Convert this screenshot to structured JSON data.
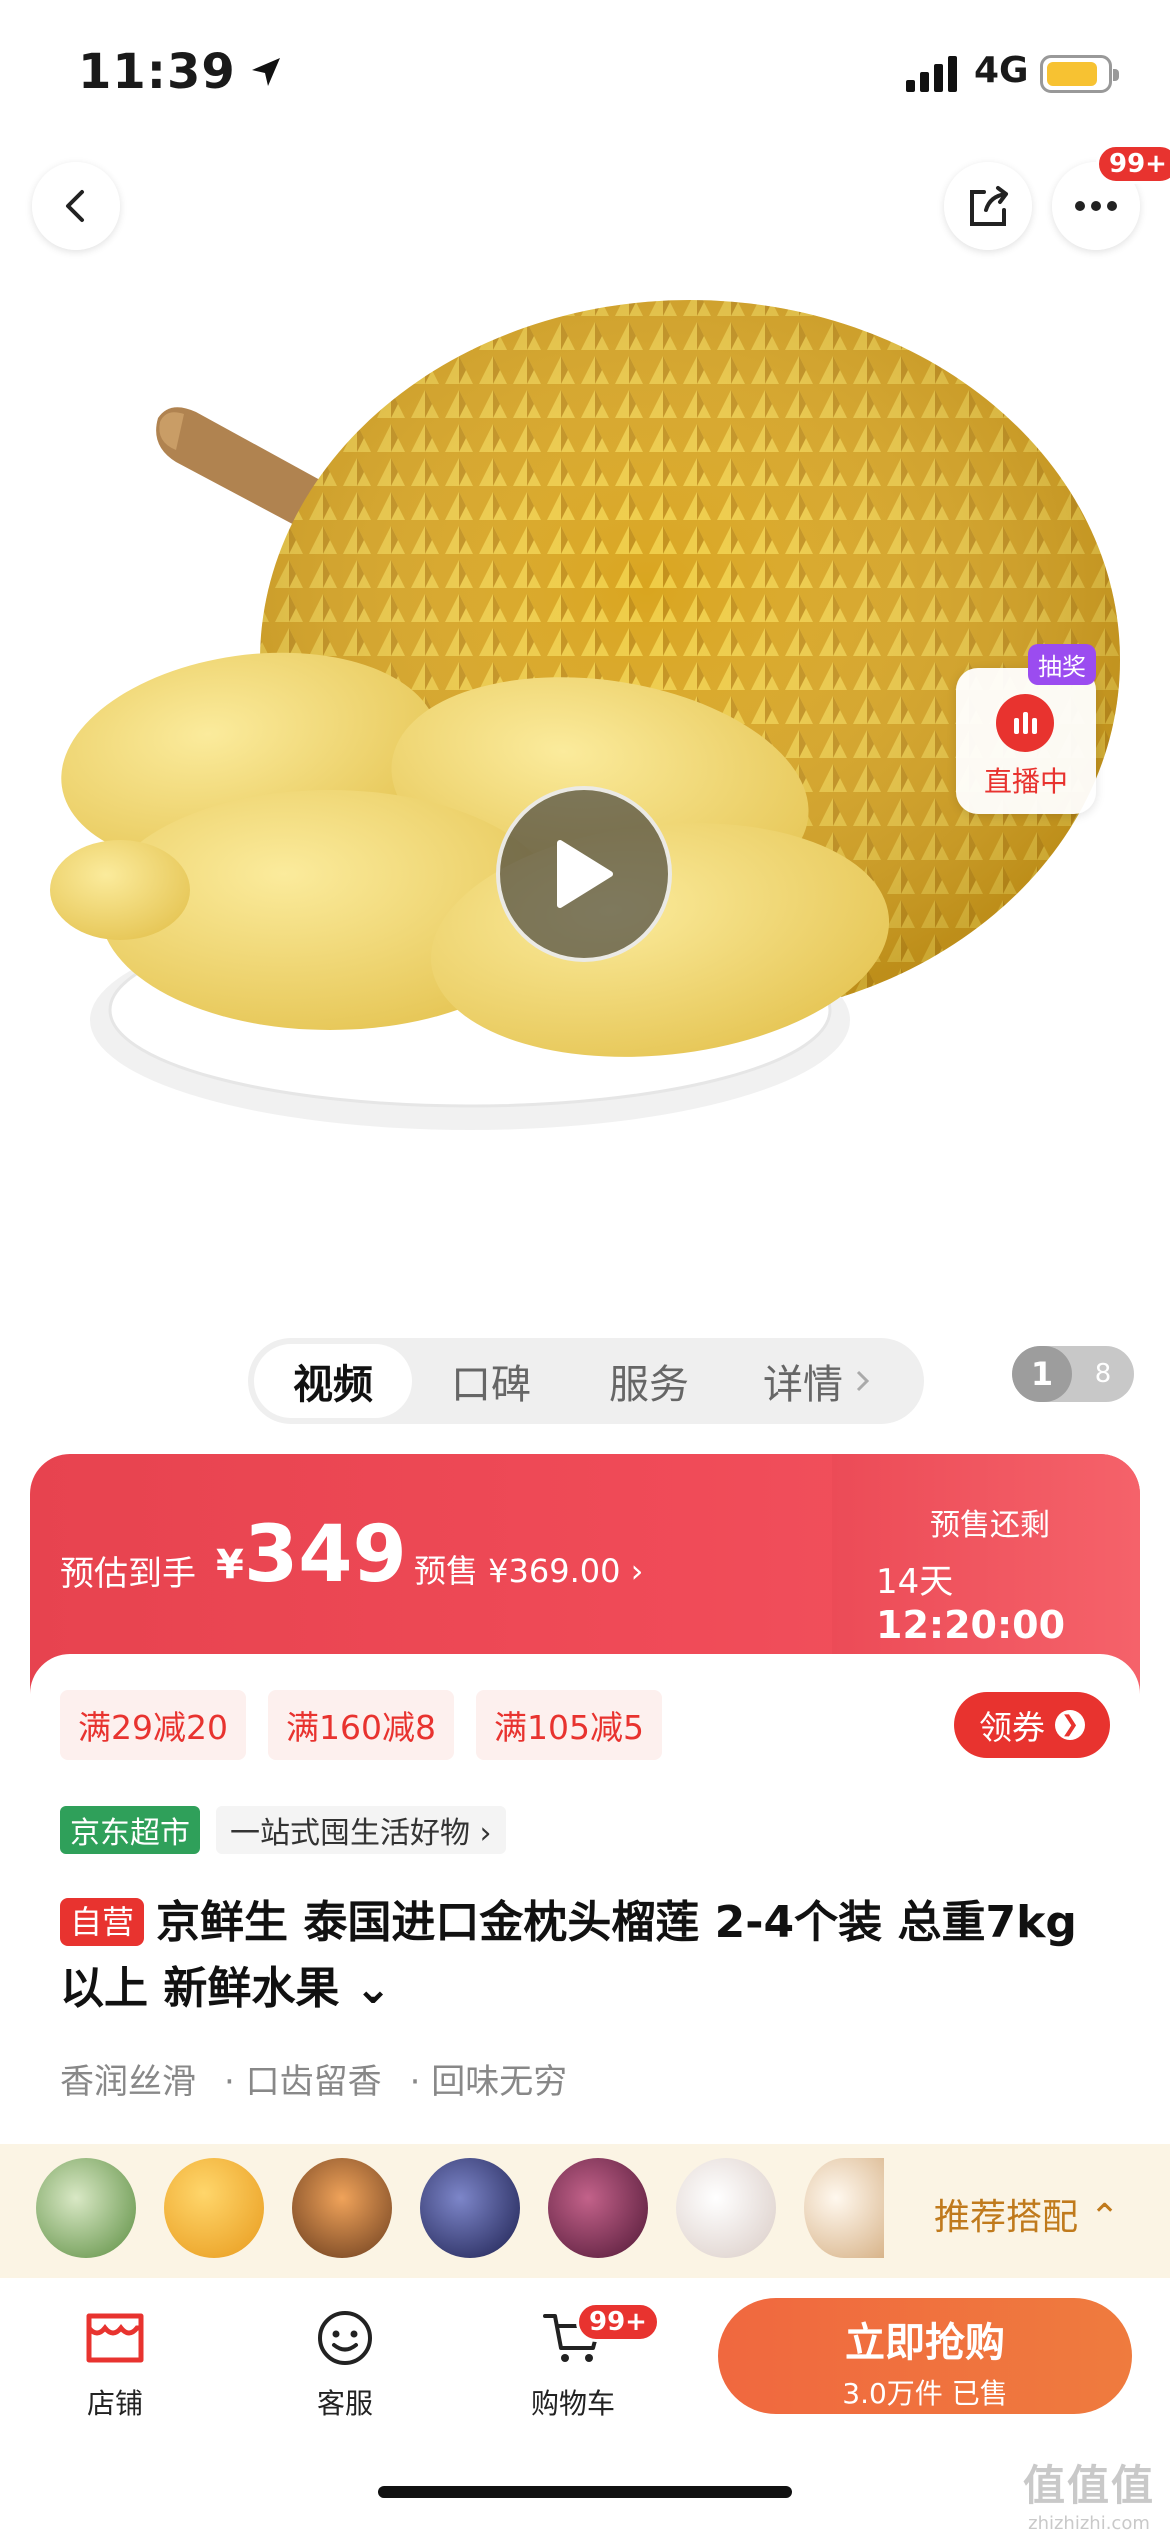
{
  "status": {
    "time": "11:39",
    "network": "4G"
  },
  "top_bar": {
    "more_badge": "99+"
  },
  "hero": {
    "live_lottery": "抽奖",
    "live_label": "直播中",
    "pager_current": "1",
    "pager_total": "8"
  },
  "tabs": [
    {
      "label": "视频"
    },
    {
      "label": "口碑"
    },
    {
      "label": "服务"
    },
    {
      "label": "详情"
    }
  ],
  "price": {
    "estimate_label": "预估到手",
    "currency": "¥",
    "amount": "349",
    "presale_text": "预售 ¥369.00 ›",
    "remain_label": "预售还剩",
    "remain_days": "14天",
    "remain_time": "12:20:00"
  },
  "coupons": [
    "满29减20",
    "满160减8",
    "满105减5"
  ],
  "get_coupon": "领券",
  "store": {
    "tag": "京东超市",
    "slogan": "一站式囤生活好物 ›"
  },
  "product": {
    "self_run": "自营",
    "title": "京鲜生 泰国进口金枕头榴莲 2-4个装 总重7kg以上 新鲜水果 ⌄",
    "features": [
      "香润丝滑",
      "· 口齿留香",
      "· 回味无穷"
    ]
  },
  "recommend": {
    "label": "推荐搭配 ⌃"
  },
  "bottom_nav": {
    "shop": "店铺",
    "service": "客服",
    "cart": "购物车",
    "cart_badge": "99+",
    "buy_main": "立即抢购",
    "buy_sub": "3.0万件 已售"
  },
  "watermark": {
    "glyph": "值值值",
    "site": "zhizhizhi.com"
  },
  "colors": {
    "accent_red": "#e8332f",
    "buy_orange": "#ef7040",
    "store_green": "#2fa05a",
    "durian_yellow": "#e3b52a"
  }
}
